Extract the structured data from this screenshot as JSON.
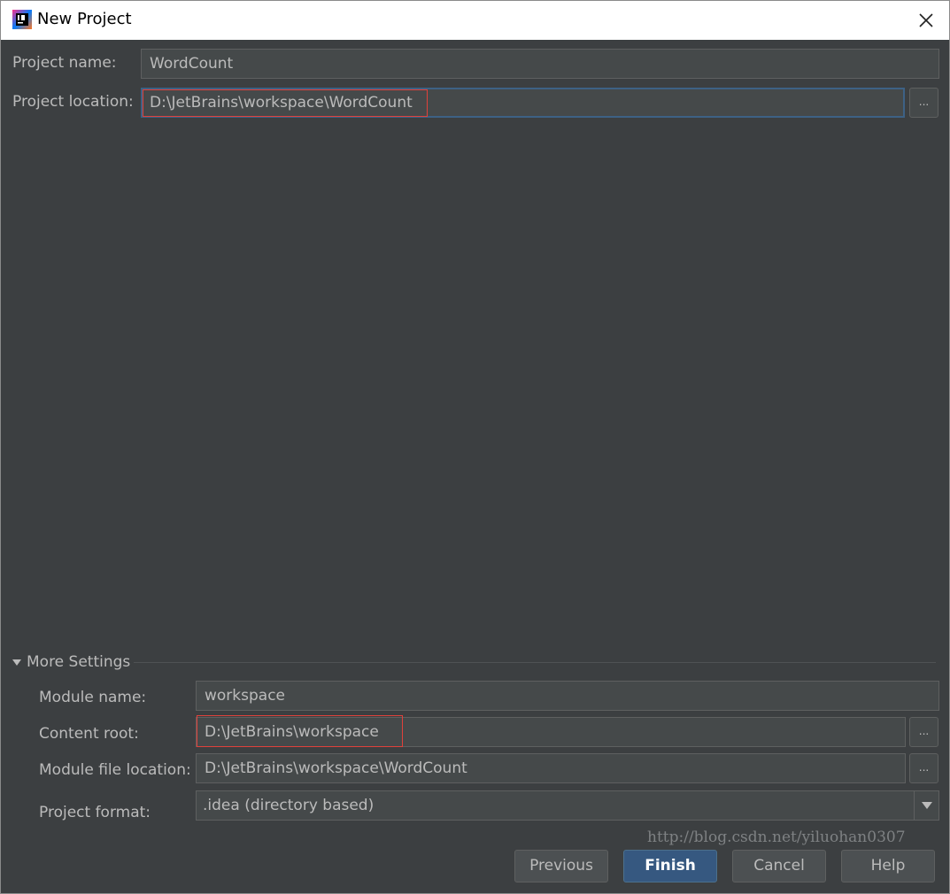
{
  "window": {
    "title": "New Project",
    "icon": "intellij-idea-icon",
    "close_icon": "close-icon"
  },
  "form": {
    "project_name_label": "Project name:",
    "project_name_value": "WordCount",
    "project_location_label": "Project location:",
    "project_location_value": "D:\\JetBrains\\workspace\\WordCount",
    "browse_label": "..."
  },
  "more_settings": {
    "title": "More Settings",
    "module_name_label": "Module name:",
    "module_name_value": "workspace",
    "content_root_label": "Content root:",
    "content_root_value": "D:\\JetBrains\\workspace",
    "module_file_location_label": "Module file location:",
    "module_file_location_value": "D:\\JetBrains\\workspace\\WordCount",
    "project_format_label": "Project format:",
    "project_format_value": ".idea (directory based)"
  },
  "buttons": {
    "previous": "Previous",
    "finish": "Finish",
    "cancel": "Cancel",
    "help": "Help"
  },
  "watermark": "http://blog.csdn.net/yiluohan0307",
  "colors": {
    "background": "#3c3f41",
    "field": "#45494a",
    "text": "#bbbbbb",
    "highlight": "#e0413b",
    "focus": "#3d6185",
    "default_button": "#365880"
  }
}
